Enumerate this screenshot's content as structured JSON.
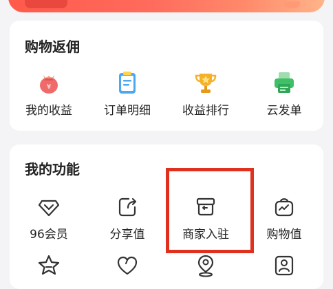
{
  "rebate": {
    "title": "购物返佣",
    "items": [
      {
        "label": "我的收益",
        "icon": "money-bag-icon"
      },
      {
        "label": "订单明细",
        "icon": "clipboard-icon"
      },
      {
        "label": "收益排行",
        "icon": "trophy-icon"
      },
      {
        "label": "云发单",
        "icon": "printer-icon"
      }
    ]
  },
  "functions": {
    "title": "我的功能",
    "items": [
      {
        "label": "96会员",
        "icon": "diamond-icon"
      },
      {
        "label": "分享值",
        "icon": "share-icon"
      },
      {
        "label": "商家入驻",
        "icon": "store-box-icon"
      },
      {
        "label": "购物值",
        "icon": "shopping-bag-icon"
      },
      {
        "label": "",
        "icon": "star-icon"
      },
      {
        "label": "",
        "icon": "heart-icon"
      },
      {
        "label": "",
        "icon": "location-pin-icon"
      },
      {
        "label": "",
        "icon": "contact-card-icon"
      }
    ]
  },
  "colors": {
    "accent": "#ff5a4a",
    "highlight": "#e0301e"
  }
}
